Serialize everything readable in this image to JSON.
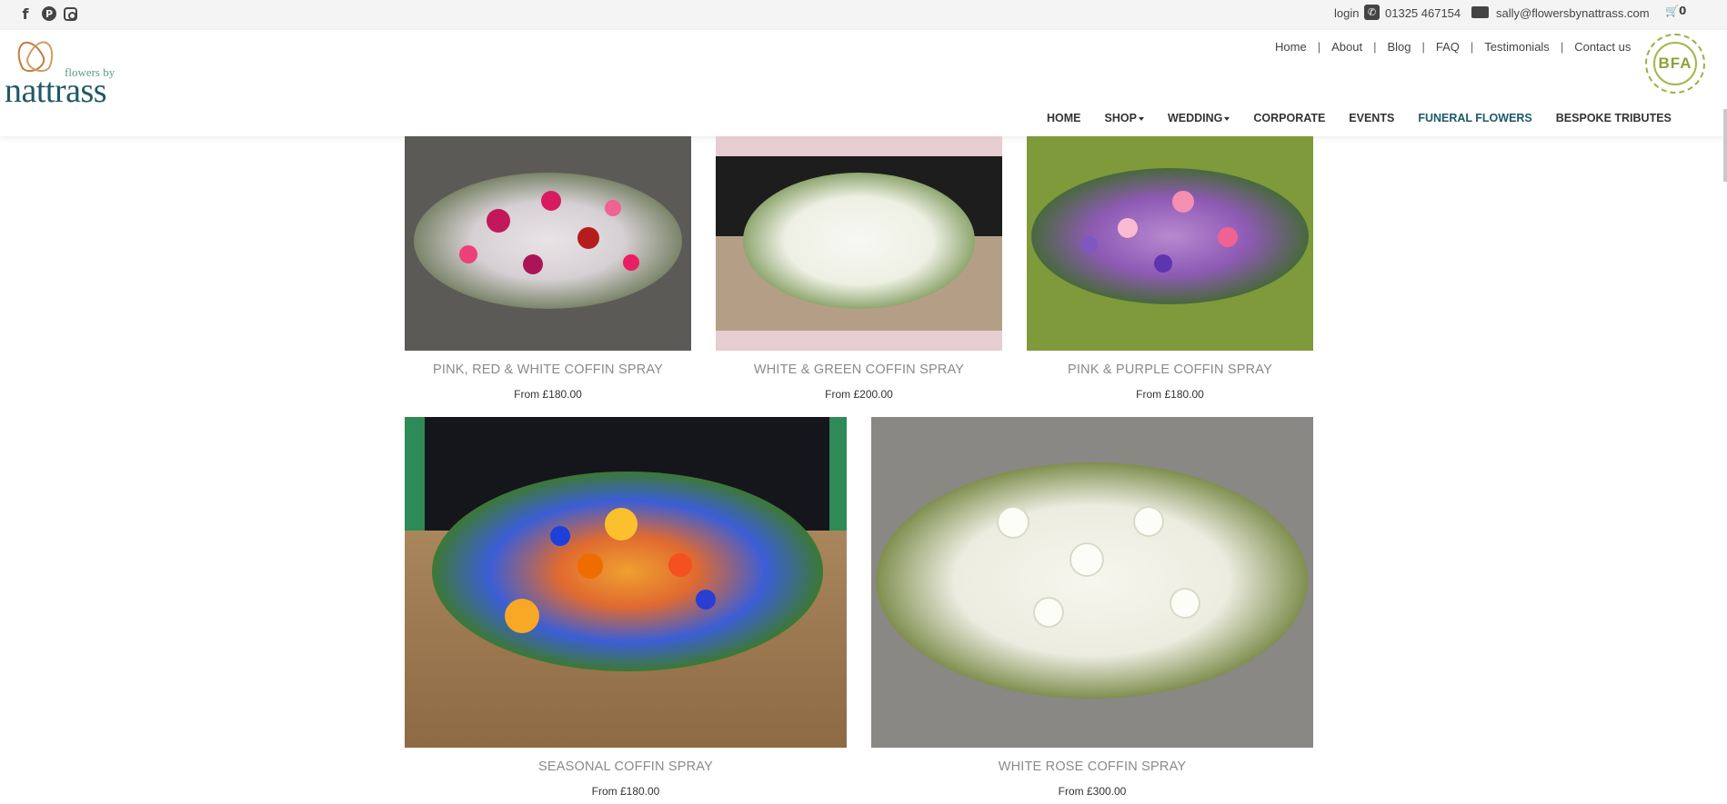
{
  "topbar": {
    "social_icons": [
      "facebook-icon",
      "pinterest-icon",
      "instagram-icon"
    ],
    "login_label": "login",
    "phone": "01325 467154",
    "email": "sally@flowersbynattrass.com",
    "cart_count": "0"
  },
  "logo": {
    "tagline": "flowers by",
    "name": "nattrass"
  },
  "util_nav": [
    "Home",
    "About",
    "Blog",
    "FAQ",
    "Testimonials",
    "Contact us"
  ],
  "badge": {
    "text": "BFA"
  },
  "main_nav": [
    {
      "label": "HOME",
      "dropdown": false,
      "active": false
    },
    {
      "label": "SHOP",
      "dropdown": true,
      "active": false
    },
    {
      "label": "WEDDING",
      "dropdown": true,
      "active": false
    },
    {
      "label": "CORPORATE",
      "dropdown": false,
      "active": false
    },
    {
      "label": "EVENTS",
      "dropdown": false,
      "active": false
    },
    {
      "label": "FUNERAL FLOWERS",
      "dropdown": false,
      "active": true
    },
    {
      "label": "BESPOKE TRIBUTES",
      "dropdown": false,
      "active": false
    }
  ],
  "products": [
    {
      "title": "PINK, RED & WHITE COFFIN SPRAY",
      "price": "From £180.00"
    },
    {
      "title": "WHITE & GREEN COFFIN SPRAY",
      "price": "From £200.00"
    },
    {
      "title": "PINK & PURPLE COFFIN SPRAY",
      "price": "From £180.00"
    },
    {
      "title": "SEASONAL COFFIN SPRAY",
      "price": "From £180.00"
    },
    {
      "title": "WHITE ROSE COFFIN SPRAY",
      "price": "From £300.00"
    }
  ],
  "colors": {
    "brand_teal": "#1d5b6b",
    "brand_copper": "#c47a3a",
    "badge_green": "#8aa436"
  }
}
